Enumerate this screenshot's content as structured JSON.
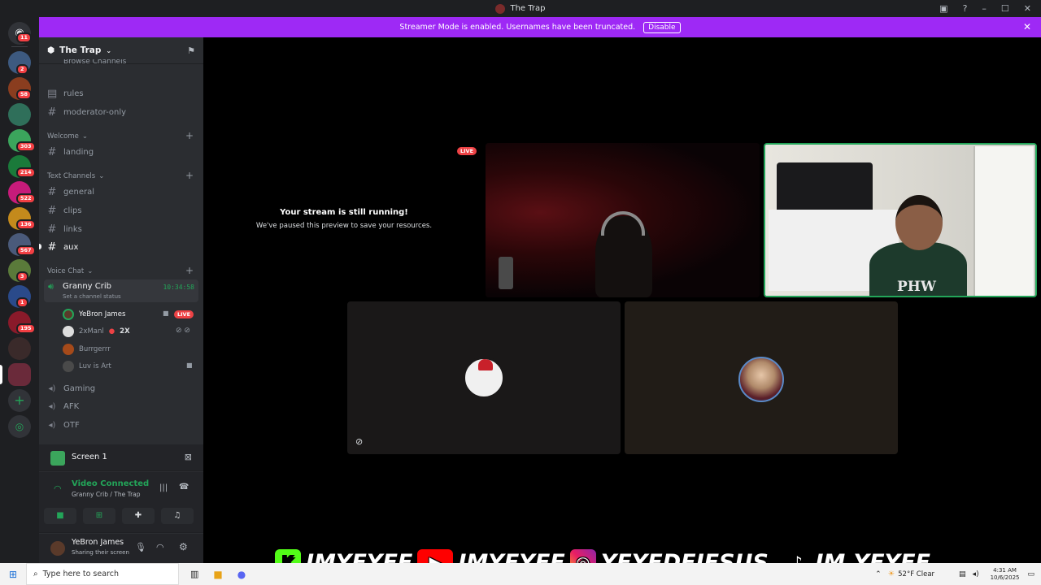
{
  "window": {
    "title": "The Trap"
  },
  "banner": {
    "text": "Streamer Mode is enabled. Usernames have been truncated.",
    "button": "Disable"
  },
  "guilds": [
    {
      "badge": "11"
    },
    {
      "badge": "2"
    },
    {
      "badge": "58"
    },
    {
      "badge": ""
    },
    {
      "badge": "303"
    },
    {
      "badge": "214"
    },
    {
      "badge": "522"
    },
    {
      "badge": "136"
    },
    {
      "badge": "567"
    },
    {
      "badge": "3"
    },
    {
      "badge": "1"
    },
    {
      "badge": "195"
    },
    {
      "badge": ""
    },
    {
      "badge": ""
    }
  ],
  "server": {
    "name": "The Trap",
    "cut_label": "Browse Channels"
  },
  "channels": {
    "rules": "rules",
    "moderator": "moderator-only",
    "cat_welcome": "Welcome",
    "landing": "landing",
    "cat_text": "Text Channels",
    "general": "general",
    "clips": "clips",
    "links": "links",
    "aux": "aux",
    "cat_voice": "Voice Chat",
    "granny": "Granny Crib",
    "granny_time": "10:34:58",
    "granny_status": "Set a channel status",
    "gaming": "Gaming",
    "afk": "AFK",
    "otf": "OTF"
  },
  "voice_users": [
    {
      "name": "YeBron James",
      "live": "LIVE"
    },
    {
      "name": "2xManl",
      "extra": "2X"
    },
    {
      "name": "Burrgerrr"
    },
    {
      "name": "Luv is Art"
    }
  ],
  "panel": {
    "screen": "Screen 1",
    "status": "Video Connected",
    "location": "Granny Crib / The Trap",
    "user": "YeBron James",
    "user_status": "Sharing their screen"
  },
  "stream": {
    "live": "LIVE",
    "paused_title": "Your stream is still running!",
    "paused_sub": "We've paused this preview to save your resources.",
    "shirt_text": "PHW"
  },
  "overlay": {
    "kick": "IMYEYEE",
    "youtube": "IMYEYEE",
    "instagram": "YEYEDEJESUS_",
    "tiktok": "IM.YEYEE"
  },
  "taskbar": {
    "search_placeholder": "Type here to search",
    "weather": "52°F  Clear",
    "time": "4:31 AM",
    "date": "10/6/2025"
  },
  "colors": {
    "accent": "#9e29f5",
    "live": "#ed4245",
    "speaking": "#23a559"
  }
}
